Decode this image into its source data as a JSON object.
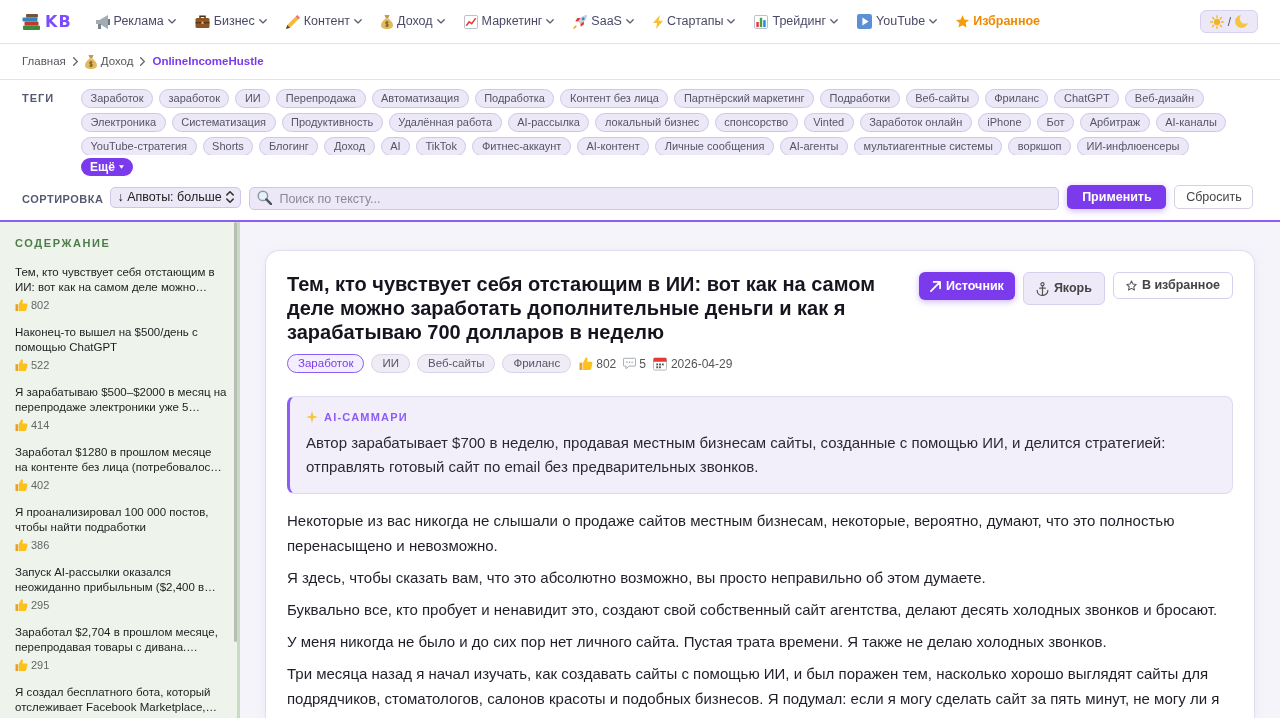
{
  "nav": {
    "logo": "KB",
    "items": [
      {
        "label": "Реклама",
        "kind": "dropdown"
      },
      {
        "label": "Бизнес",
        "kind": "dropdown"
      },
      {
        "label": "Контент",
        "kind": "dropdown"
      },
      {
        "label": "Доход",
        "kind": "dropdown"
      },
      {
        "label": "Маркетинг",
        "kind": "dropdown"
      },
      {
        "label": "SaaS",
        "kind": "dropdown"
      },
      {
        "label": "Стартапы",
        "kind": "dropdown"
      },
      {
        "label": "Трейдинг",
        "kind": "dropdown"
      },
      {
        "label": "YouTube",
        "kind": "dropdown"
      },
      {
        "label": "Избранное",
        "kind": "featured"
      }
    ],
    "theme_toggle": {
      "separator": "/"
    }
  },
  "breadcrumb": [
    {
      "label": "Главная",
      "current": false
    },
    {
      "label": "Доход",
      "current": false
    },
    {
      "label": "OnlineIncomeHustle",
      "current": true
    }
  ],
  "filters": {
    "tags_label": "ТЕГИ",
    "tag_rows": [
      [
        "Заработок",
        "заработок",
        "ИИ",
        "Перепродажа",
        "Автоматизация",
        "Подработка",
        "Контент без лица",
        "Партнёрский маркетинг",
        "Подработки",
        "Веб-сайты",
        "Фриланс",
        "ChatGPT",
        "Веб-дизайн"
      ],
      [
        "Электроника",
        "Систематизация",
        "Продуктивность",
        "Удалённая работа",
        "AI-рассылка",
        "локальный бизнес",
        "спонсорство",
        "Vinted",
        "Заработок онлайн",
        "iPhone",
        "Бот",
        "Арбитраж",
        "AI-каналы"
      ],
      [
        "YouTube-стратегия",
        "Shorts",
        "Блогинг",
        "Доход",
        "AI",
        "TikTok",
        "Фитнес-аккаунт",
        "AI-контент",
        "Личные сообщения",
        "AI-агенты",
        "мультиагентные системы",
        "воркшоп",
        "ИИ-инфлюенсеры"
      ]
    ],
    "more_button": "Ещё",
    "sort_label": "СОРТИРОВКА",
    "sort_select": "↓ Апвоты: больше",
    "search": {
      "placeholder": "Поиск по тексту..."
    },
    "apply_button": "Применить",
    "reset_button": "Сбросить"
  },
  "sidebar": {
    "heading": "СОДЕРЖАНИЕ",
    "items": [
      {
        "title": "Тем, кто чувствует себя отстающим в ИИ: вот как на самом деле можно…",
        "upvotes": "802"
      },
      {
        "title": "Наконец-то вышел на $500/день с помощью ChatGPT",
        "upvotes": "522"
      },
      {
        "title": "Я зарабатываю $500–$2000 в месяц на перепродаже электроники уже 5…",
        "upvotes": "414"
      },
      {
        "title": "Заработал $1280 в прошлом месяце на контенте без лица (потребовалос…",
        "upvotes": "402"
      },
      {
        "title": "Я проанализировал 100 000 постов, чтобы найти подработки",
        "upvotes": "386"
      },
      {
        "title": "Запуск AI-рассылки оказался неожиданно прибыльным ($2,400 в…",
        "upvotes": "295"
      },
      {
        "title": "Заработал $2,704 в прошлом месяце, перепродавая товары с дивана.…",
        "upvotes": "291"
      },
      {
        "title": "Я создал бесплатного бота, который отслеживает Facebook Marketplace,…"
      }
    ]
  },
  "article": {
    "title": "Тем, кто чувствует себя отстающим в ИИ: вот как на самом деле можно заработать дополнительные деньги и как я зарабатываю 700 долларов в неделю",
    "buttons": [
      {
        "label": "Источник",
        "kind": "primary"
      },
      {
        "label": "Якорь",
        "kind": "secondary"
      },
      {
        "label": "В избранное",
        "kind": "outline"
      }
    ],
    "tags": [
      {
        "label": "Заработок",
        "selected": true
      },
      {
        "label": "ИИ",
        "selected": false
      },
      {
        "label": "Веб-сайты",
        "selected": false
      },
      {
        "label": "Фриланс",
        "selected": false
      }
    ],
    "upvotes": "802",
    "comments": "5",
    "date": "2026-04-29",
    "summary": {
      "heading": "AI-САММАРИ",
      "text": "Автор зарабатывает $700 в неделю, продавая местным бизнесам сайты, созданные с помощью ИИ, и делится стратегией: отправлять готовый сайт по email без предварительных звонков."
    },
    "paragraphs": [
      "Некоторые из вас никогда не слышали о продаже сайтов местным бизнесам, некоторые, вероятно, думают, что это полностью перенасыщено и невозможно.",
      "Я здесь, чтобы сказать вам, что это абсолютно возможно, вы просто неправильно об этом думаете.",
      "Буквально все, кто пробует и ненавидит это, создают свой собственный сайт агентства, делают десять холодных звонков и бросают.",
      "У меня никогда не было и до сих пор нет личного сайта. Пустая трата времени. Я также не делаю холодных звонков.",
      "Три месяца назад я начал изучать, как создавать сайты с помощью ИИ, и был поражен тем, насколько хорошо выглядят сайты для подрядчиков, стоматологов, салонов красоты и подобных бизнесов. Я подумал: если я могу сделать сайт за пять минут, не могу ли я"
    ]
  }
}
